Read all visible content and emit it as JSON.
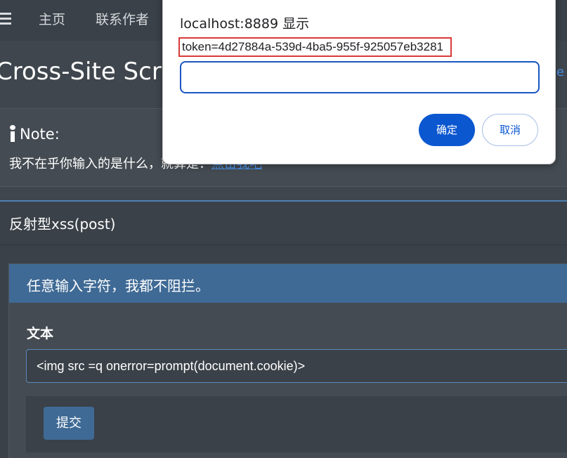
{
  "navbar": {
    "links": [
      "主页",
      "联系作者"
    ]
  },
  "page": {
    "title": "Cross-Site Script",
    "right_link_fragment": "e"
  },
  "note": {
    "title": "Note:",
    "text": "我不在乎你输入的是什么，就算是：",
    "link": "点击我吧"
  },
  "card": {
    "title": "反射型xss(post)",
    "panel_header": "任意输入字符，我都不阻拦。",
    "field_label": "文本",
    "input_value": "<img src =q onerror=prompt(document.cookie)>",
    "submit_label": "提交"
  },
  "dialog": {
    "title": "localhost:8889 显示",
    "message": "token=4d27884a-539d-4ba5-955f-925057eb3281",
    "input_value": "",
    "ok_label": "确定",
    "cancel_label": "取消"
  },
  "colors": {
    "accent": "#4f7fb4",
    "panel_header": "#3f6a95",
    "dialog_primary": "#0b57d0",
    "highlight_border": "#d83a3a"
  }
}
